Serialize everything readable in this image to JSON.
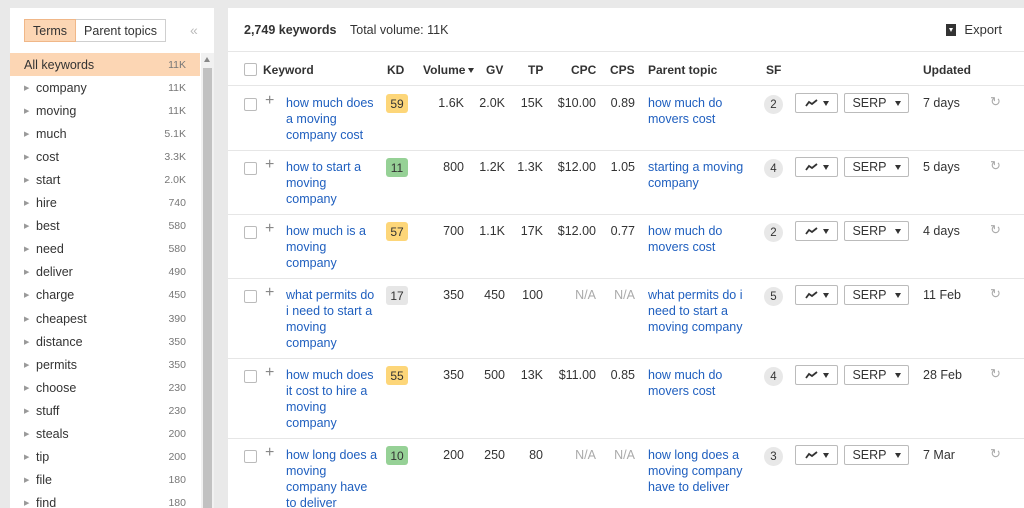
{
  "sidebar": {
    "tabs": [
      "Terms",
      "Parent topics"
    ],
    "collapse_icon": "«",
    "items": [
      {
        "label": "All keywords",
        "count": "11K"
      },
      {
        "label": "company",
        "count": "11K"
      },
      {
        "label": "moving",
        "count": "11K"
      },
      {
        "label": "much",
        "count": "5.1K"
      },
      {
        "label": "cost",
        "count": "3.3K"
      },
      {
        "label": "start",
        "count": "2.0K"
      },
      {
        "label": "hire",
        "count": "740"
      },
      {
        "label": "best",
        "count": "580"
      },
      {
        "label": "need",
        "count": "580"
      },
      {
        "label": "deliver",
        "count": "490"
      },
      {
        "label": "charge",
        "count": "450"
      },
      {
        "label": "cheapest",
        "count": "390"
      },
      {
        "label": "distance",
        "count": "350"
      },
      {
        "label": "permits",
        "count": "350"
      },
      {
        "label": "choose",
        "count": "230"
      },
      {
        "label": "stuff",
        "count": "230"
      },
      {
        "label": "steals",
        "count": "200"
      },
      {
        "label": "tip",
        "count": "200"
      },
      {
        "label": "file",
        "count": "180"
      },
      {
        "label": "find",
        "count": "180"
      }
    ]
  },
  "header": {
    "keyword_count": "2,749 keywords",
    "total_volume": "Total volume: 11K",
    "export_label": "Export"
  },
  "columns": {
    "keyword": "Keyword",
    "kd": "KD",
    "volume": "Volume",
    "gv": "GV",
    "tp": "TP",
    "cpc": "CPC",
    "cps": "CPS",
    "parent_topic": "Parent topic",
    "sf": "SF",
    "updated": "Updated"
  },
  "colors": {
    "kd_yellow": "#fdd679",
    "kd_green": "#96d196",
    "kd_gray": "#e6e6e6",
    "link": "#1f5fbf",
    "active_bg": "#fcd6b4"
  },
  "rows": [
    {
      "keyword": "how much does a moving company cost",
      "kd": "59",
      "kd_color": "#fdd679",
      "volume": "1.6K",
      "gv": "2.0K",
      "tp": "15K",
      "cpc": "$10.00",
      "cps": "0.89",
      "parent": "how much do movers cost",
      "sf": "2",
      "serp": "SERP",
      "updated": "7 days"
    },
    {
      "keyword": "how to start a moving company",
      "kd": "11",
      "kd_color": "#96d196",
      "volume": "800",
      "gv": "1.2K",
      "tp": "1.3K",
      "cpc": "$12.00",
      "cps": "1.05",
      "parent": "starting a moving company",
      "sf": "4",
      "serp": "SERP",
      "updated": "5 days"
    },
    {
      "keyword": "how much is a moving company",
      "kd": "57",
      "kd_color": "#fdd679",
      "volume": "700",
      "gv": "1.1K",
      "tp": "17K",
      "cpc": "$12.00",
      "cps": "0.77",
      "parent": "how much do movers cost",
      "sf": "2",
      "serp": "SERP",
      "updated": "4 days"
    },
    {
      "keyword": "what permits do i need to start a moving company",
      "kd": "17",
      "kd_color": "#e6e6e6",
      "volume": "350",
      "gv": "450",
      "tp": "100",
      "cpc": "N/A",
      "cps": "N/A",
      "parent": "what permits do i need to start a moving company",
      "sf": "5",
      "serp": "SERP",
      "updated": "11 Feb"
    },
    {
      "keyword": "how much does it cost to hire a moving company",
      "kd": "55",
      "kd_color": "#fdd679",
      "volume": "350",
      "gv": "500",
      "tp": "13K",
      "cpc": "$11.00",
      "cps": "0.85",
      "parent": "how much do movers cost",
      "sf": "4",
      "serp": "SERP",
      "updated": "28 Feb"
    },
    {
      "keyword": "how long does a moving company have to deliver",
      "kd": "10",
      "kd_color": "#96d196",
      "volume": "200",
      "gv": "250",
      "tp": "80",
      "cpc": "N/A",
      "cps": "N/A",
      "parent": "how long does a moving company have to deliver",
      "sf": "3",
      "serp": "SERP",
      "updated": "7 Mar"
    }
  ]
}
